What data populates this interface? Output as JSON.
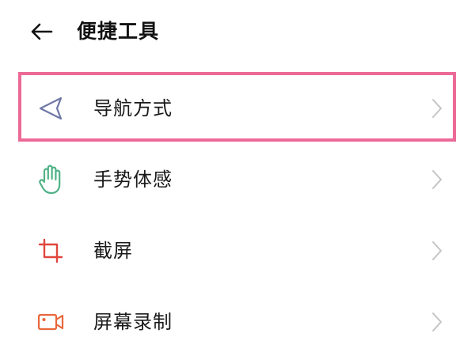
{
  "header": {
    "title": "便捷工具",
    "back_icon": "arrow-left-icon"
  },
  "items": [
    {
      "label": "导航方式",
      "icon": "navigation-triangle-icon",
      "icon_color": "#6f78a6",
      "chevron": "chevron-right-icon"
    },
    {
      "label": "手势体感",
      "icon": "hand-gesture-icon",
      "icon_color": "#4fb286",
      "chevron": "chevron-right-icon"
    },
    {
      "label": "截屏",
      "icon": "crop-icon",
      "icon_color": "#e0463c",
      "chevron": "chevron-right-icon"
    },
    {
      "label": "屏幕录制",
      "icon": "video-camera-icon",
      "icon_color": "#e8663a",
      "chevron": "chevron-right-icon"
    }
  ],
  "highlight": {
    "target": "导航方式",
    "color": "#ec6a97"
  }
}
